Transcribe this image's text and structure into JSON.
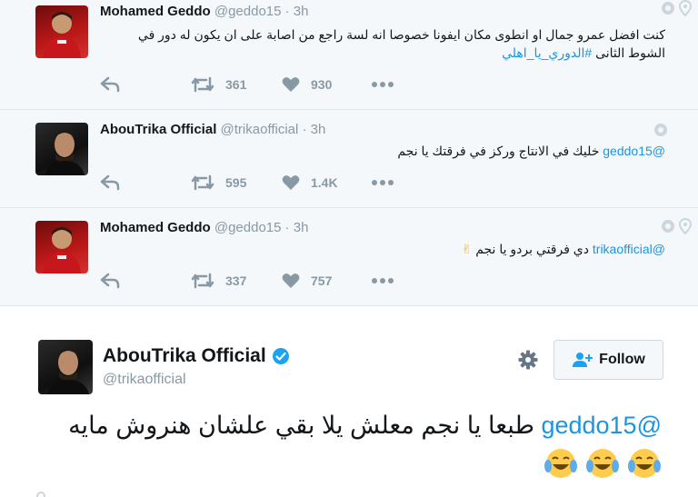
{
  "replies": [
    {
      "name": "Mohamed Geddo",
      "handle": "@geddo15",
      "time": "· 3h",
      "text_plain": "كنت افضل عمرو جمال او انطوى مكان ايفونا خصوصا انه لسة راجع من اصابة على ان يكون له دور في الشوط الثانى",
      "hashtag": "#الدوري_يا_اهلي",
      "retweets": "361",
      "likes": "930"
    },
    {
      "name": "AbouTrika Official",
      "handle": "@trikaofficial",
      "time": "· 3h",
      "mention": "@geddo15",
      "text_plain": "خليك في الانتاج وركز في فرقتك يا نجم",
      "retweets": "595",
      "likes": "1.4K"
    },
    {
      "name": "Mohamed Geddo",
      "handle": "@geddo15",
      "time": "· 3h",
      "mention": "@trikaofficial",
      "text_plain": "دي فرقتي بردو يا نجم",
      "emoji": "✌",
      "retweets": "337",
      "likes": "757"
    }
  ],
  "main_tweet": {
    "name": "AbouTrika Official",
    "handle": "@trikaofficial",
    "follow_label": "Follow",
    "mention": "@geddo15",
    "text_plain": "طبعا يا نجم معلش يلا بقي علشان هنروش مايه",
    "emojis": [
      "face-with-tears-of-joy",
      "face-with-tears-of-joy",
      "face-with-tears-of-joy"
    ]
  },
  "colors": {
    "link": "#1b95e0",
    "muted": "#8899a6",
    "reply_bg": "#f5f8fa",
    "verified": "#1da1f2"
  }
}
